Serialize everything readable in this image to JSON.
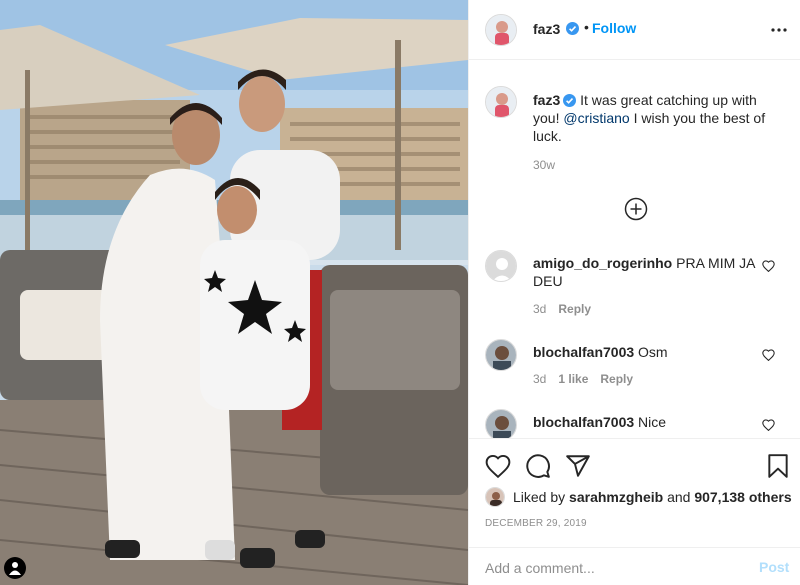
{
  "post": {
    "author": "faz3",
    "follow_label": "Follow",
    "separator": "•",
    "caption_text": "It was great catching up with you!",
    "caption_mention": "@cristiano",
    "caption_tail": "I wish you the best of luck.",
    "caption_time": "30w"
  },
  "comments": [
    {
      "username": "amigo_do_rogerinho",
      "text": "PRA MIM JA DEU",
      "time": "3d",
      "likes": "",
      "reply_label": "Reply"
    },
    {
      "username": "blochalfan7003",
      "text": "Osm",
      "time": "3d",
      "likes": "1 like",
      "reply_label": "Reply"
    },
    {
      "username": "blochalfan7003",
      "text": "Nice",
      "time": "",
      "likes": "",
      "reply_label": ""
    }
  ],
  "likes": {
    "prefix": "Liked by",
    "user": "sarahmzgheib",
    "conj": "and",
    "count": "907,138 others"
  },
  "date": "DECEMBER 29, 2019",
  "composer": {
    "placeholder": "Add a comment...",
    "post_label": "Post"
  },
  "colors": {
    "link": "#0095f6",
    "mention": "#00376b",
    "secondary": "#8e8e8e",
    "verified": "#3897f0",
    "post_disabled": "#b2dffc"
  },
  "icons": [
    "verified-badge-icon",
    "more-options-icon",
    "load-more-comments-icon",
    "heart-icon",
    "comment-icon",
    "share-icon",
    "bookmark-icon",
    "user-tag-icon"
  ]
}
